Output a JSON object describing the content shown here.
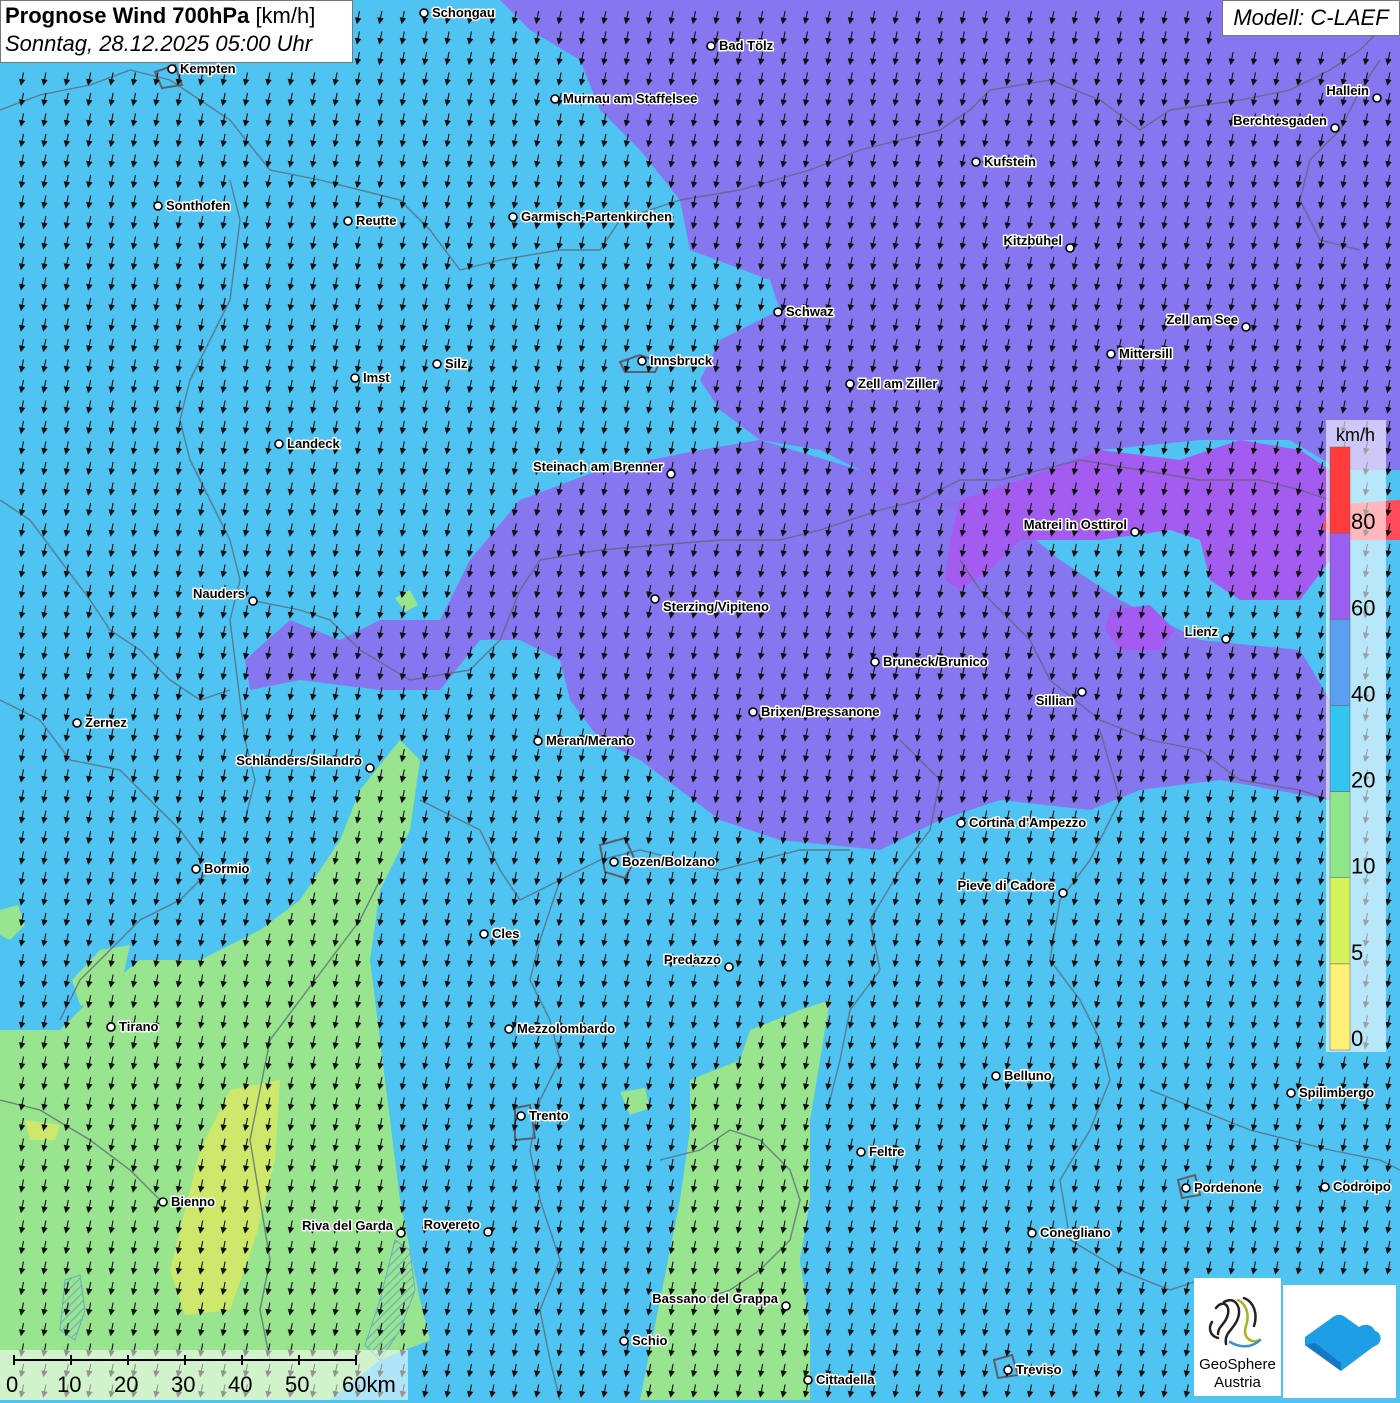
{
  "header": {
    "title_bold": "Prognose Wind 700hPa",
    "title_unit": "[km/h]",
    "datetime": "Sonntag, 28.12.2025 05:00 Uhr"
  },
  "model_label": "Modell: C-LAEF",
  "legend": {
    "unit": "km/h",
    "ticks": [
      "0",
      "5",
      "10",
      "20",
      "40",
      "60",
      "80"
    ],
    "colors": [
      "#fff176",
      "#d6f25a",
      "#8fe68a",
      "#33c4ef",
      "#5a9ff0",
      "#9a5ef0",
      "#ff3b3b"
    ]
  },
  "map_colors": {
    "base_blue": "#4fc3f2",
    "violet": "#8c6ff0",
    "strong_violet": "#a45cf0",
    "green": "#98e48f",
    "yellow_green": "#cde86a",
    "deep_blue": "#5d9ef2",
    "red": "#ff4b5c"
  },
  "wind_direction": "south-southwest arrows",
  "cities": [
    {
      "name": "Schongau"
    },
    {
      "name": "Bad Tölz"
    },
    {
      "name": "Kempten"
    },
    {
      "name": "Murnau am Staffelsee"
    },
    {
      "name": "Hallein"
    },
    {
      "name": "Berchtesgaden"
    },
    {
      "name": "Kufstein"
    },
    {
      "name": "Sonthofen"
    },
    {
      "name": "Reutte"
    },
    {
      "name": "Garmisch-Partenkirchen"
    },
    {
      "name": "Kitzbühel"
    },
    {
      "name": "Schwaz"
    },
    {
      "name": "Zell am See"
    },
    {
      "name": "Mittersill"
    },
    {
      "name": "Innsbruck"
    },
    {
      "name": "Silz"
    },
    {
      "name": "Imst"
    },
    {
      "name": "Zell am Ziller"
    },
    {
      "name": "Landeck"
    },
    {
      "name": "Steinach am Brenner"
    },
    {
      "name": "Matrei in Osttirol"
    },
    {
      "name": "Nauders"
    },
    {
      "name": "Sterzing/Vipiteno"
    },
    {
      "name": "Lienz"
    },
    {
      "name": "Bruneck/Brunico"
    },
    {
      "name": "Sillian"
    },
    {
      "name": "Brixen/Bressanone"
    },
    {
      "name": "Zernez"
    },
    {
      "name": "Meran/Merano"
    },
    {
      "name": "Schlanders/Silandro"
    },
    {
      "name": "Cortina d'Ampezzo"
    },
    {
      "name": "Bozen/Bolzano"
    },
    {
      "name": "Bormio"
    },
    {
      "name": "Pieve di Cadore"
    },
    {
      "name": "Cles"
    },
    {
      "name": "Predazzo"
    },
    {
      "name": "Tirano"
    },
    {
      "name": "Mezzolombardo"
    },
    {
      "name": "Belluno"
    },
    {
      "name": "Spilimbergo"
    },
    {
      "name": "Trento"
    },
    {
      "name": "Feltre"
    },
    {
      "name": "Pordenone"
    },
    {
      "name": "Codroipo"
    },
    {
      "name": "Bienno"
    },
    {
      "name": "Riva del Garda"
    },
    {
      "name": "Rovereto"
    },
    {
      "name": "Conegliano"
    },
    {
      "name": "Bassano del Grappa"
    },
    {
      "name": "Schio"
    },
    {
      "name": "Treviso"
    },
    {
      "name": "Cittadella"
    }
  ],
  "scale_bar": {
    "labels": [
      "0",
      "10",
      "20",
      "30",
      "40",
      "50",
      "60km"
    ]
  },
  "logos": {
    "geosphere_line1": "GeoSphere",
    "geosphere_line2": "Austria"
  }
}
